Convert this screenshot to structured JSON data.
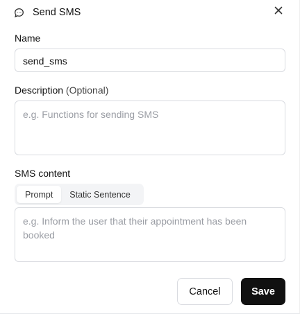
{
  "dialog": {
    "title": "Send SMS",
    "icon": "chat-bubble-icon",
    "close_icon": "close-icon"
  },
  "name_field": {
    "label": "Name",
    "value": "send_sms"
  },
  "description_field": {
    "label": "Description",
    "optional_label": "(Optional)",
    "placeholder": "e.g. Functions for sending SMS"
  },
  "sms_content": {
    "label": "SMS content",
    "tabs": [
      {
        "label": "Prompt",
        "active": true
      },
      {
        "label": "Static Sentence",
        "active": false
      }
    ],
    "placeholder": "e.g. Inform the user that their appointment has been booked"
  },
  "actions": {
    "cancel_label": "Cancel",
    "save_label": "Save"
  },
  "colors": {
    "primary_button": "#111111",
    "border": "#d9dbe0",
    "placeholder": "#9a9da4"
  }
}
